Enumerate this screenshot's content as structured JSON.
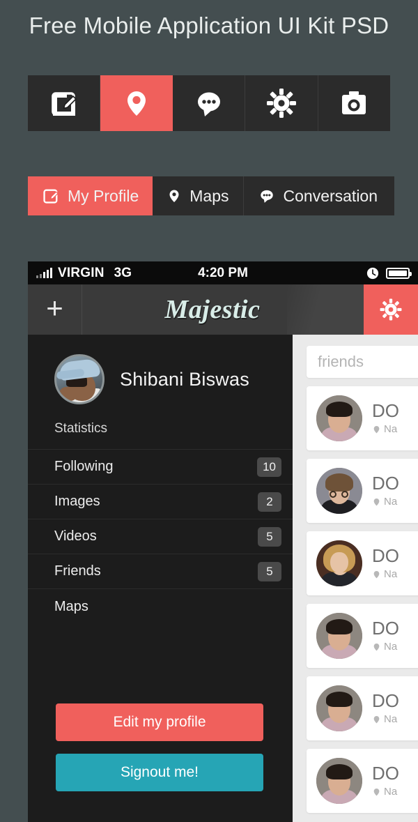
{
  "page": {
    "title": "Free Mobile Application UI Kit PSD",
    "background_color": "#444E50",
    "accent_color": "#F0605C",
    "teal_color": "#26A5B5",
    "dark_panel_color": "#1C1C1C"
  },
  "icon_strip": {
    "items": [
      {
        "name": "compose-icon",
        "active": false
      },
      {
        "name": "location-pin-icon",
        "active": true
      },
      {
        "name": "chat-bubble-icon",
        "active": false
      },
      {
        "name": "gear-icon",
        "active": false
      },
      {
        "name": "camera-icon",
        "active": false
      }
    ]
  },
  "tabs": [
    {
      "label": "My Profile",
      "icon": "compose-icon",
      "active": true
    },
    {
      "label": "Maps",
      "icon": "location-pin-icon",
      "active": false
    },
    {
      "label": "Conversation",
      "icon": "chat-bubble-icon",
      "active": false
    }
  ],
  "phone": {
    "status_bar": {
      "carrier": "VIRGIN",
      "network": "3G",
      "time": "4:20 PM",
      "clock_icon": "clock-icon",
      "battery_icon": "battery-full-icon"
    },
    "header": {
      "add_label": "+",
      "title": "Majestic",
      "settings_icon": "gear-icon"
    },
    "profile": {
      "name": "Shibani Biswas",
      "avatar_alt": "user-avatar",
      "statistics_label": "Statistics",
      "menu": [
        {
          "label": "Following",
          "badge": "10"
        },
        {
          "label": "Images",
          "badge": "2"
        },
        {
          "label": "Videos",
          "badge": "5"
        },
        {
          "label": "Friends",
          "badge": "5"
        },
        {
          "label": "Maps",
          "badge": ""
        }
      ],
      "edit_button": "Edit my profile",
      "signout_button": "Signout me!"
    },
    "friends_panel": {
      "search_placeholder": "friends",
      "search_value": "",
      "cards": [
        {
          "name": "DO",
          "location": "Na"
        },
        {
          "name": "DO",
          "location": "Na"
        },
        {
          "name": "DO",
          "location": "Na"
        },
        {
          "name": "DO",
          "location": "Na"
        },
        {
          "name": "DO",
          "location": "Na"
        },
        {
          "name": "DO",
          "location": "Na"
        }
      ]
    }
  }
}
